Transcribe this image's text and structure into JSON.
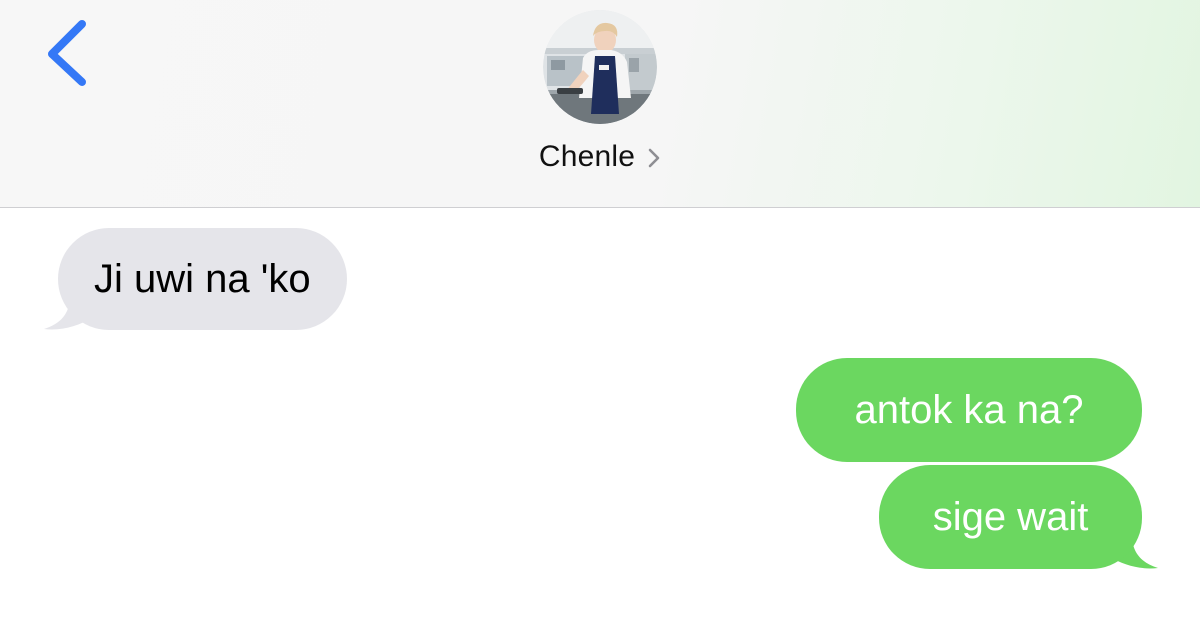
{
  "header": {
    "back_icon": "chevron-left-icon",
    "avatar_icon": "contact-avatar",
    "contact_name": "Chenle",
    "contact_chevron_icon": "chevron-right-icon"
  },
  "messages": [
    {
      "direction": "received",
      "text": "Ji uwi na 'ko"
    },
    {
      "direction": "sent",
      "text": "antok ka na?"
    },
    {
      "direction": "sent",
      "text": "sige wait"
    }
  ],
  "colors": {
    "accent_blue": "#3478f6",
    "received_bubble": "#e5e5ea",
    "sent_bubble": "#6bd760",
    "apron_navy": "#1f2e5c"
  }
}
